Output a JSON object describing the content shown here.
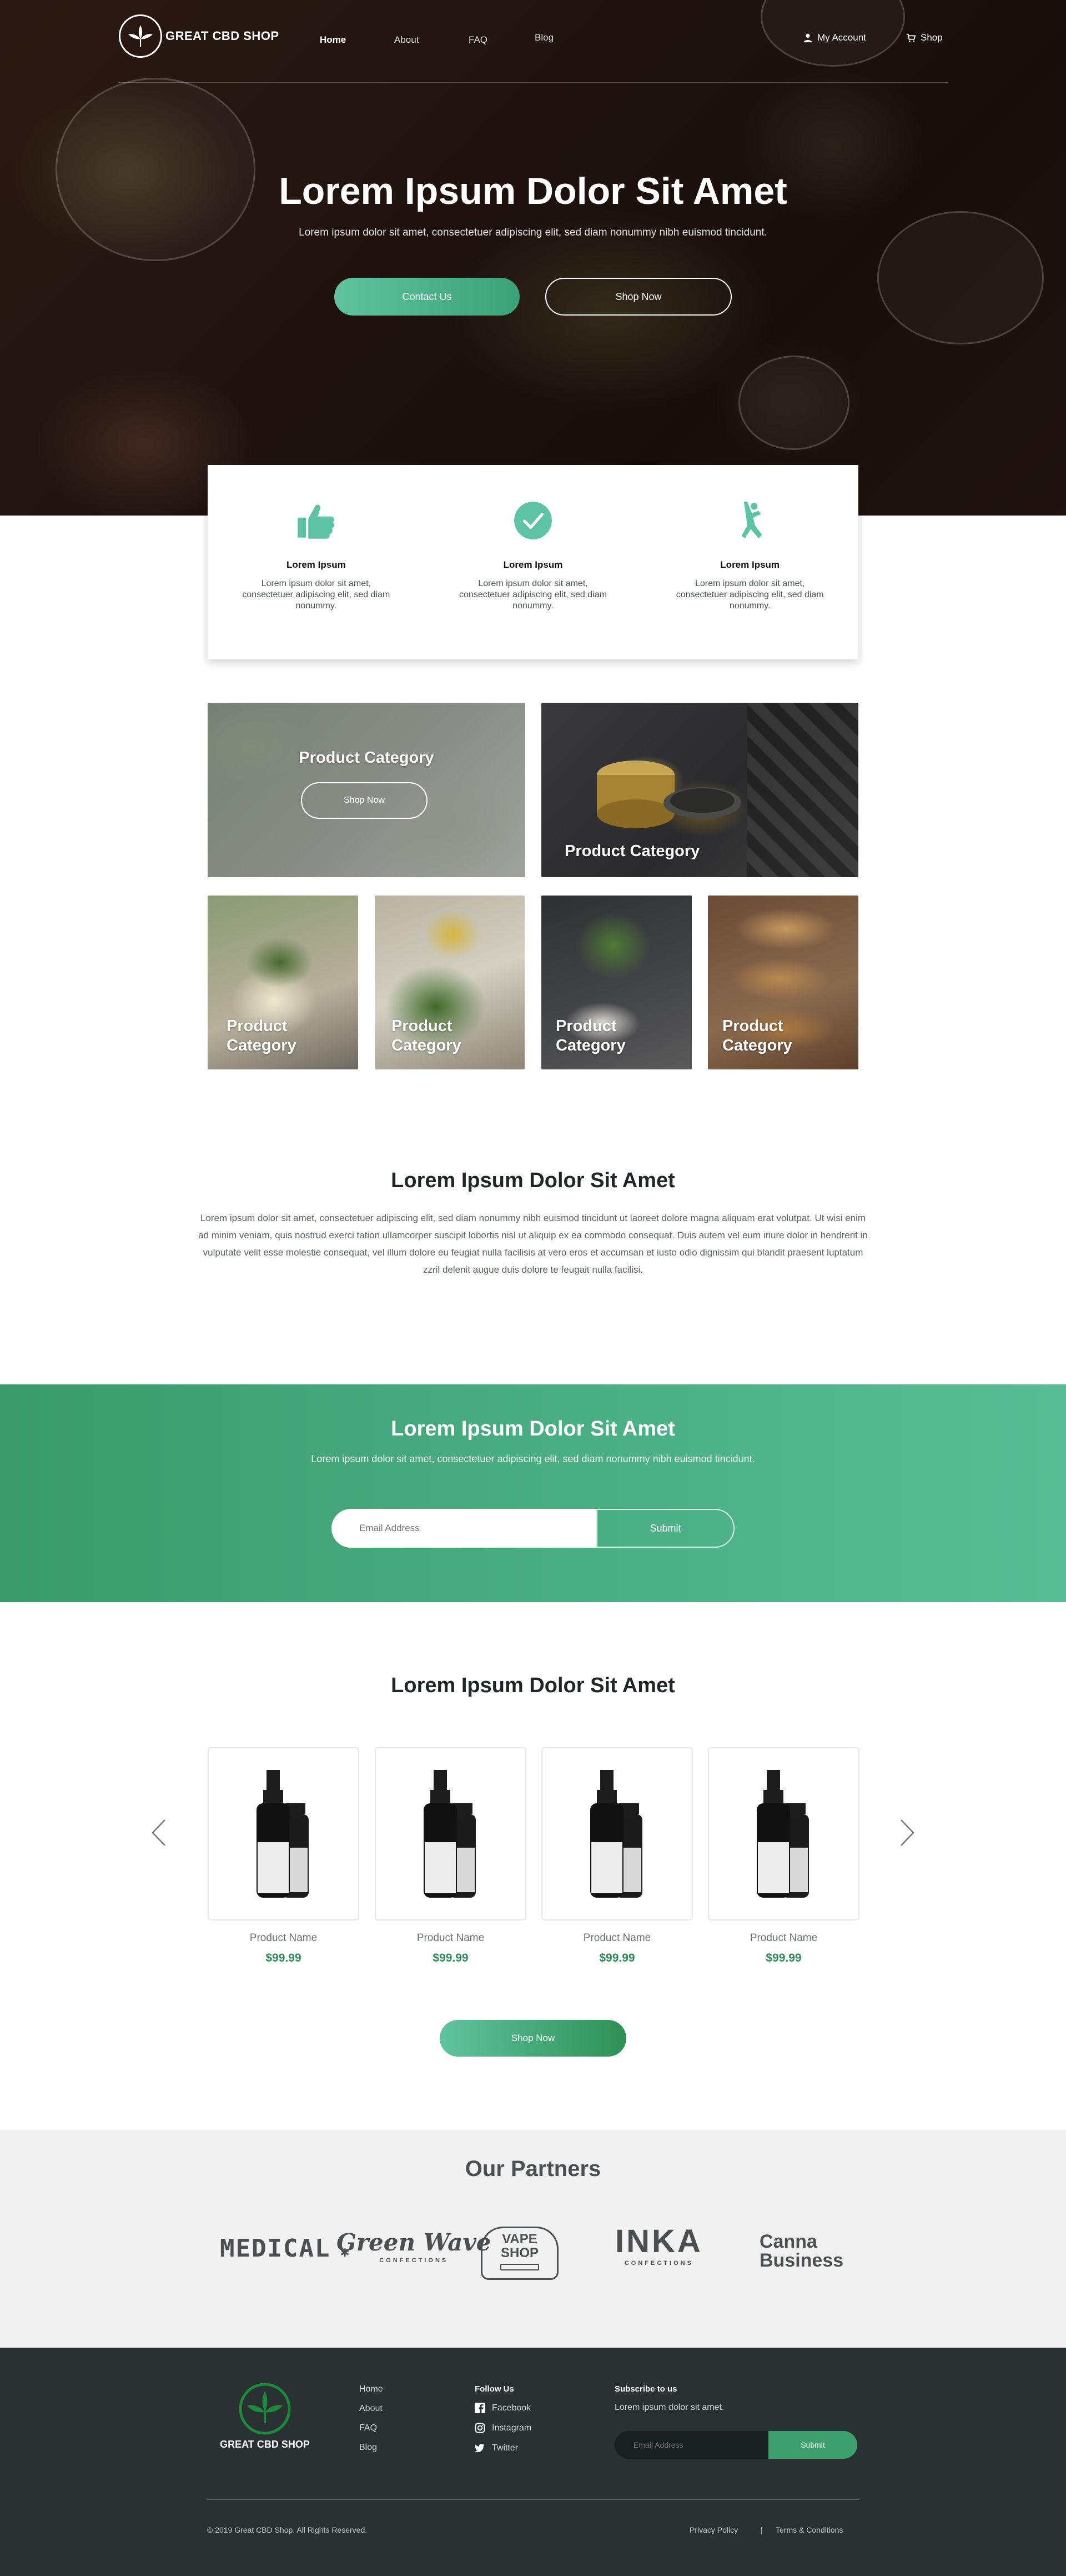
{
  "brand": {
    "name": "GREAT CBD SHOP",
    "accent": "#3ca178",
    "accent_light": "#5fc3a0",
    "dark": "#2a3133"
  },
  "nav": {
    "links": [
      "Home",
      "About",
      "FAQ",
      "Blog"
    ],
    "account_label": "My Account",
    "shop_label": "Shop"
  },
  "hero": {
    "title": "Lorem Ipsum Dolor Sit Amet",
    "subtitle": "Lorem ipsum dolor sit amet, consectetuer adipiscing elit, sed diam nonummy nibh euismod tincidunt.",
    "primary_button": "Contact Us",
    "secondary_button": "Shop Now"
  },
  "features": [
    {
      "icon": "thumbs-up-icon",
      "title": "Lorem Ipsum",
      "text": "Lorem ipsum dolor sit amet, consectetuer adipiscing elit, sed diam nonummy."
    },
    {
      "icon": "check-circle-icon",
      "title": "Lorem Ipsum",
      "text": "Lorem ipsum dolor sit amet, consectetuer adipiscing elit, sed diam nonummy."
    },
    {
      "icon": "person-icon",
      "title": "Lorem Ipsum",
      "text": "Lorem ipsum dolor sit amet, consectetuer adipiscing elit, sed diam nonummy."
    }
  ],
  "categories": {
    "featured": {
      "label": "Product Category",
      "button": "Shop Now"
    },
    "wide": {
      "label": "Product Category"
    },
    "tiles": [
      {
        "label_1": "Product",
        "label_2": "Category"
      },
      {
        "label_1": "Product",
        "label_2": "Category"
      },
      {
        "label_1": "Product",
        "label_2": "Category"
      },
      {
        "label_1": "Product",
        "label_2": "Category"
      }
    ]
  },
  "about": {
    "title": "Lorem Ipsum Dolor Sit Amet",
    "text": "Lorem ipsum dolor sit amet, consectetuer adipiscing elit, sed diam nonummy nibh euismod tincidunt ut laoreet dolore magna aliquam erat volutpat. Ut wisi enim ad minim veniam, quis nostrud exerci tation ullamcorper suscipit lobortis nisl ut aliquip ex ea commodo consequat. Duis autem vel eum iriure dolor in hendrerit in vulputate velit esse molestie consequat, vel illum dolore eu feugiat nulla facilisis at vero eros et accumsan et iusto odio dignissim qui blandit praesent luptatum zzril delenit augue duis dolore te feugait nulla facilisi."
  },
  "newsletter": {
    "title": "Lorem Ipsum Dolor Sit Amet",
    "subtitle": "Lorem ipsum dolor sit amet, consectetuer adipiscing elit, sed diam nonummy nibh euismod tincidunt.",
    "placeholder": "Email Address",
    "submit": "Submit"
  },
  "products": {
    "title": "Lorem Ipsum Dolor Sit Amet",
    "items": [
      {
        "name": "Product Name",
        "price": "$99.99"
      },
      {
        "name": "Product Name",
        "price": "$99.99"
      },
      {
        "name": "Product Name",
        "price": "$99.99"
      },
      {
        "name": "Product Name",
        "price": "$99.99"
      }
    ],
    "button": "Shop Now"
  },
  "partners": {
    "title": "Our Partners",
    "logos": [
      {
        "text": "MEDICAL"
      },
      {
        "text": "Green Wave",
        "sub": "CONFECTIONS"
      },
      {
        "text": "VAPE",
        "text_2": "SHOP"
      },
      {
        "text": "INKA",
        "sub": "CONFECTIONS"
      },
      {
        "text": "Canna",
        "text_2": "Business"
      }
    ]
  },
  "footer": {
    "brand": "GREAT CBD SHOP",
    "links": [
      "Home",
      "About",
      "FAQ",
      "Blog"
    ],
    "follow_title": "Follow Us",
    "social": [
      {
        "icon": "facebook-icon",
        "label": "Facebook"
      },
      {
        "icon": "instagram-icon",
        "label": "Instagram"
      },
      {
        "icon": "twitter-icon",
        "label": "Twitter"
      }
    ],
    "subscribe_title": "Subscribe to us",
    "subscribe_text": "Lorem ipsum dolor sit amet.",
    "placeholder": "Email Address",
    "submit": "Submit",
    "copyright": "© 2019 Great CBD Shop. All Rights Reserved.",
    "privacy": "Privacy Policy",
    "separator": "|",
    "terms": "Terms & Conditions"
  }
}
